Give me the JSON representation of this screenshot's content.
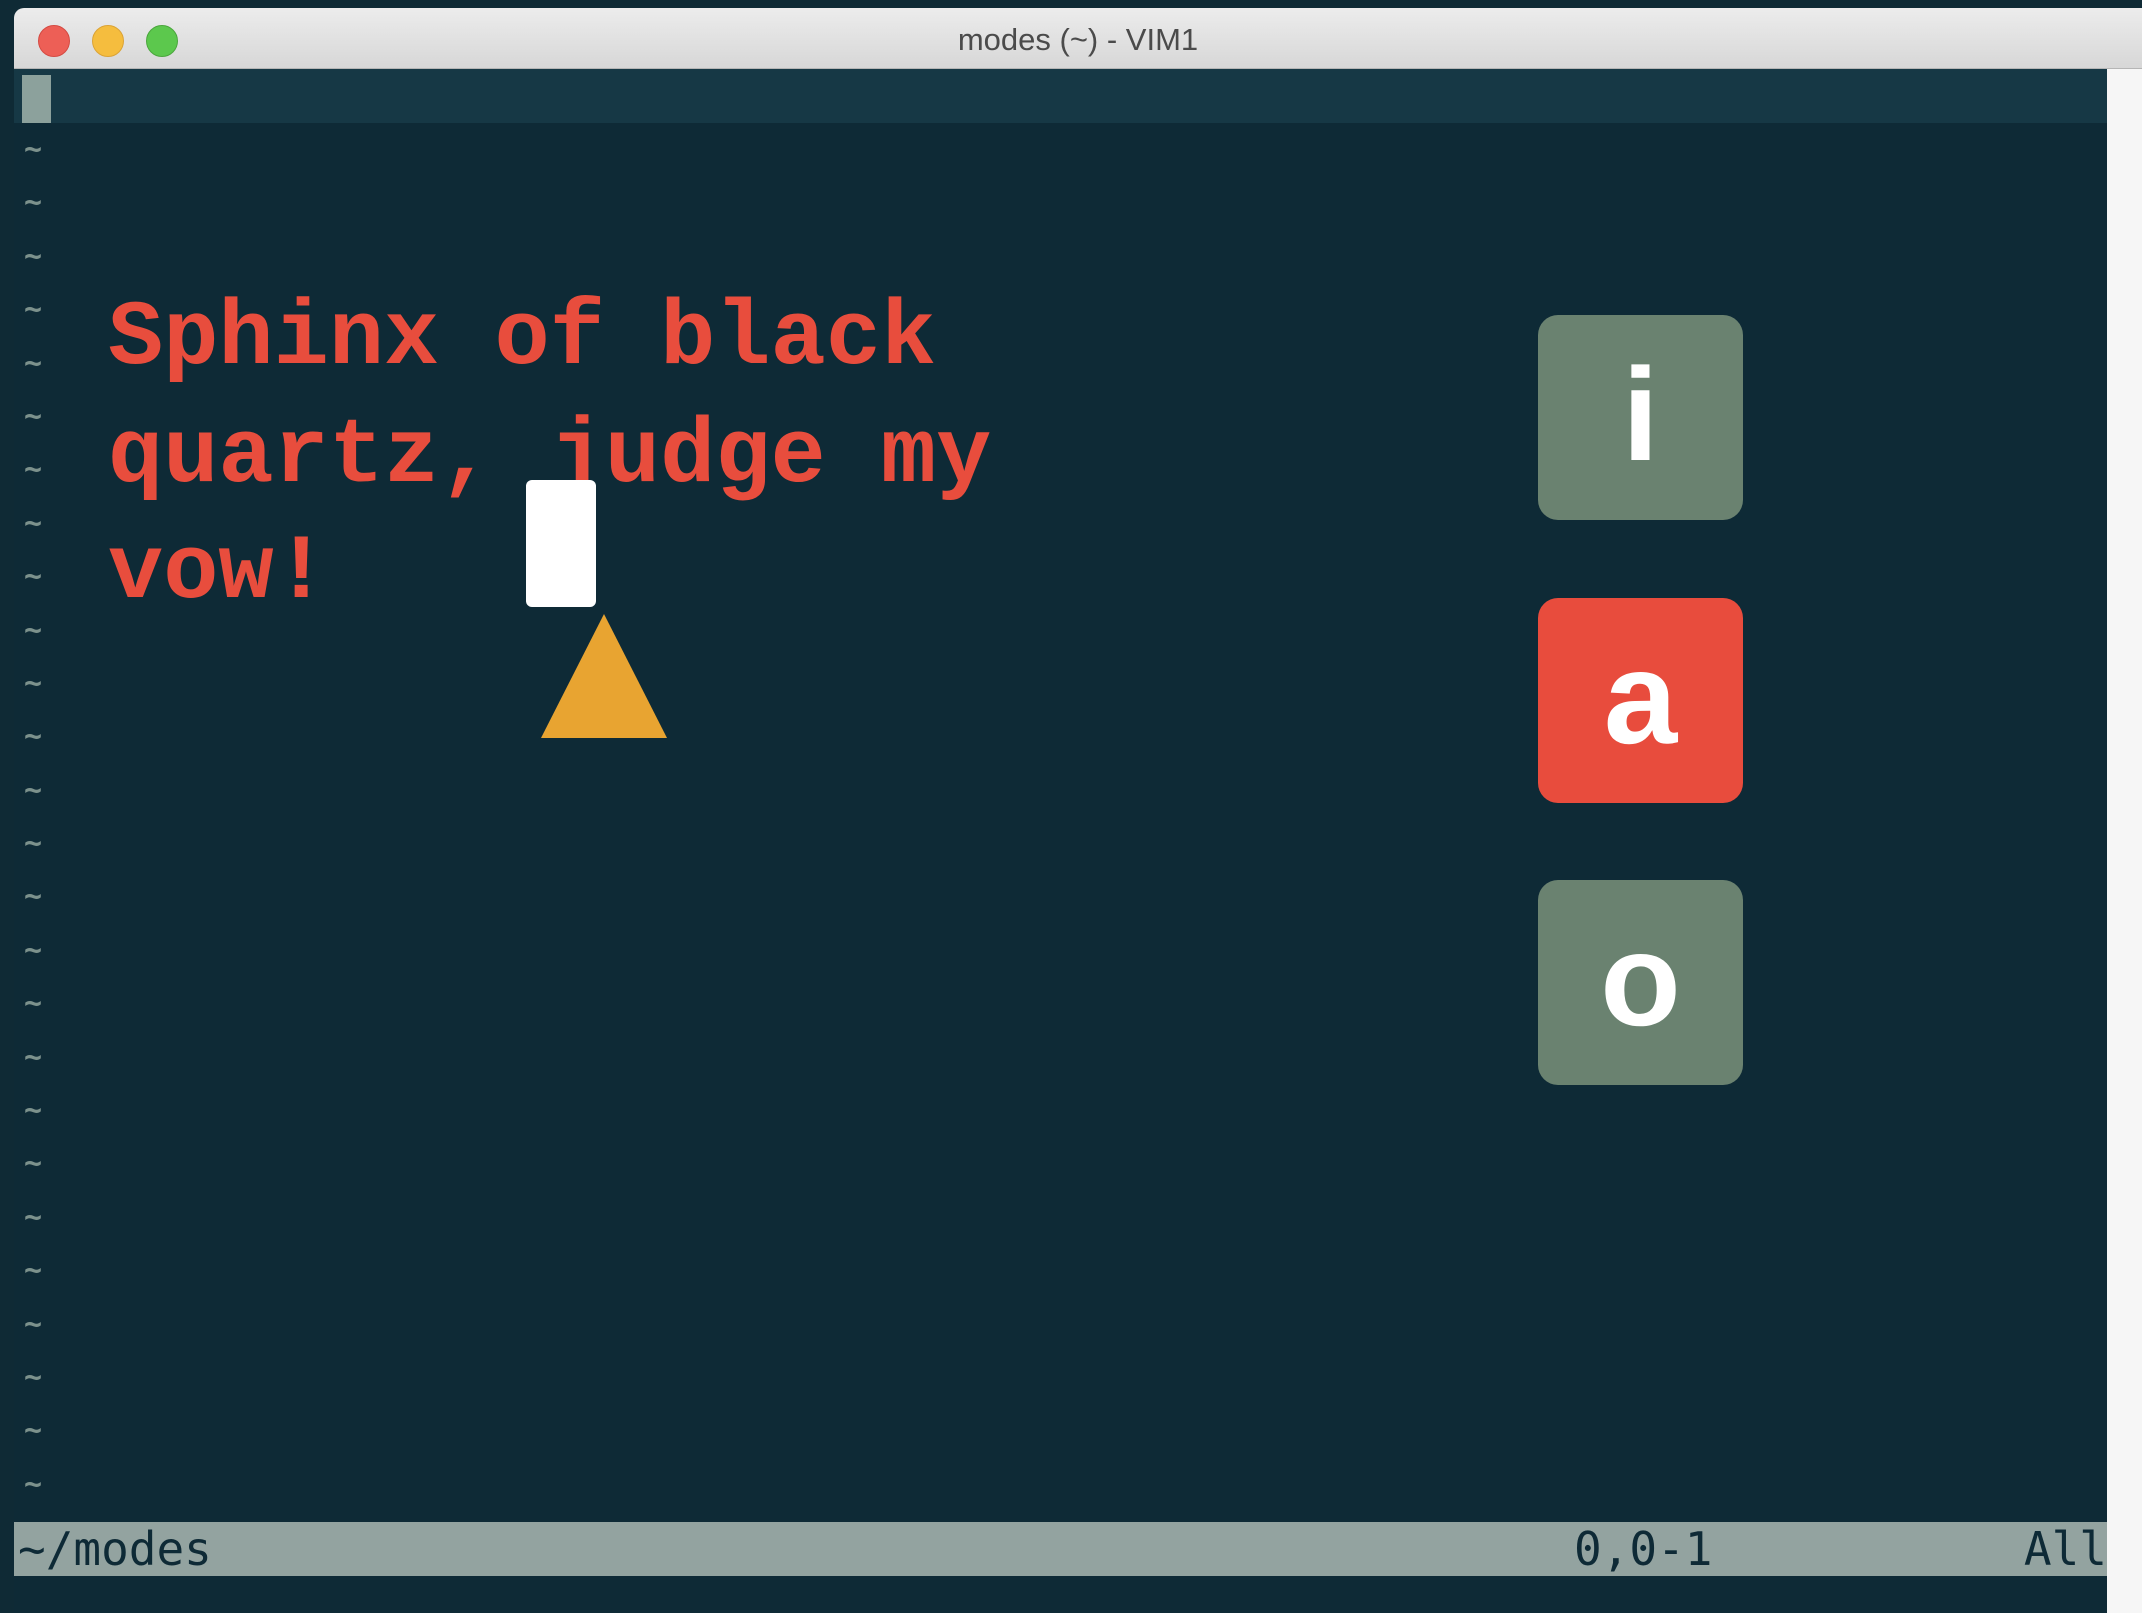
{
  "window": {
    "title": "modes (~) - VIM1"
  },
  "editor": {
    "tilde": "~",
    "lines": [
      "Sphinx of black",
      "quartz, judge my",
      "vow!"
    ]
  },
  "mode_keys": [
    {
      "label": "i",
      "color": "#6a8270",
      "active": false
    },
    {
      "label": "a",
      "color": "#e84c3d",
      "active": true
    },
    {
      "label": "o",
      "color": "#6a8270",
      "active": false
    }
  ],
  "statusline": {
    "file": "~/modes",
    "position": "0,0-1",
    "percent": "All"
  },
  "colors": {
    "background": "#0e2a36",
    "text": "#e84d3d",
    "pointer": "#e8a431",
    "key_inactive": "#6a8270",
    "key_active": "#e84c3d"
  }
}
